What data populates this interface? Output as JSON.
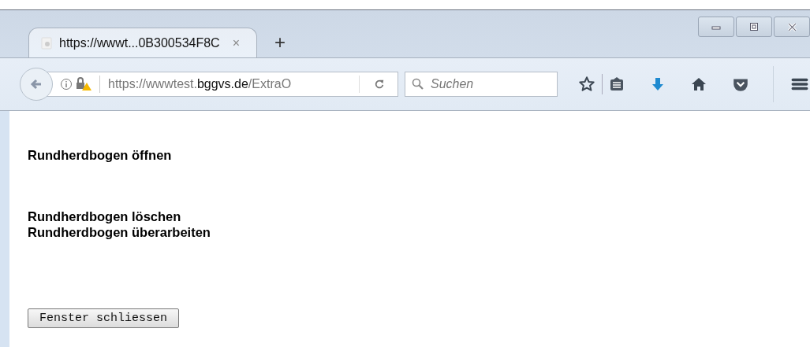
{
  "tabs": [
    {
      "title": "https://wwwt...0B300534F8C",
      "close": "×",
      "selected": true
    }
  ],
  "new_tab": "+",
  "url": "https://wwwtest.**bggvs.de**/ExtraO",
  "search": {
    "placeholder": "Suchen"
  },
  "content": {
    "link_groups": [
      [
        "Rundherdbogen öffnen"
      ],
      [
        "Rundherdbogen löschen",
        "Rundherdbogen überarbeiten"
      ]
    ],
    "button": "Fenster schliessen"
  }
}
